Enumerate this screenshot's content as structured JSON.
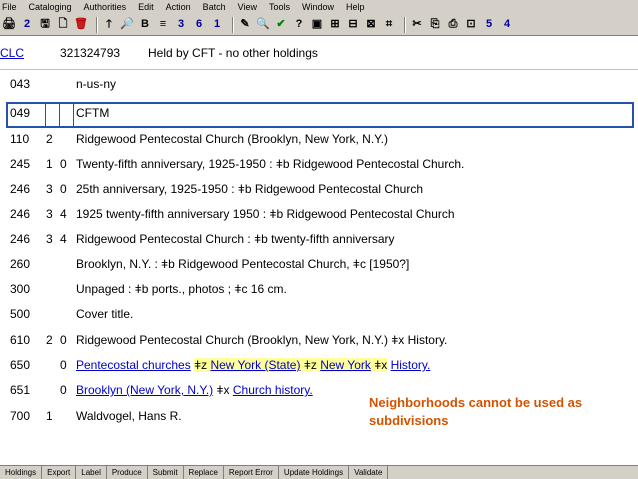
{
  "menu": [
    "File",
    "Cataloging",
    "Authorities",
    "Edit",
    "Action",
    "Batch",
    "View",
    "Tools",
    "Window",
    "Help"
  ],
  "toolbar": [
    "🖨",
    "2",
    "🖫",
    "🗋",
    "🗑",
    "🡑",
    "🔎",
    "B",
    "≡",
    "3",
    "6",
    "1",
    "✎",
    "🔍",
    "✔",
    "?",
    "▣",
    "⊞",
    "⊟",
    "⊠",
    "⌗",
    "✂",
    "⎘",
    "⎙",
    "⊡",
    "5",
    "4"
  ],
  "header": {
    "source": "CLC",
    "ocn": "321324793",
    "holdings": "Held by CFT - no other holdings"
  },
  "records": [
    {
      "tag": "043",
      "ind1": "",
      "ind2": "",
      "content": "n-us-ny"
    },
    {
      "tag": "049",
      "ind1": "",
      "ind2": "",
      "content": "CFTM"
    },
    {
      "tag": "110",
      "ind1": "2",
      "ind2": "",
      "content": "Ridgewood Pentecostal Church (Brooklyn, New York, N.Y.)"
    },
    {
      "tag": "245",
      "ind1": "1",
      "ind2": "0",
      "content": "Twenty-fifth anniversary, 1925-1950 : ǂb Ridgewood Pentecostal Church."
    },
    {
      "tag": "246",
      "ind1": "3",
      "ind2": "0",
      "content": "25th  anniversary, 1925-1950 : ǂb Ridgewood Pentecostal Church"
    },
    {
      "tag": "246",
      "ind1": "3",
      "ind2": "4",
      "content": "1925 twenty-fifth anniversary 1950 : ǂb Ridgewood Pentecostal Church"
    },
    {
      "tag": "246",
      "ind1": "3",
      "ind2": "4",
      "content": "Ridgewood Pentecostal Church : ǂb twenty-fifth anniversary"
    },
    {
      "tag": "260",
      "ind1": "",
      "ind2": "",
      "content": "Brooklyn, N.Y. : ǂb Ridgewood Pentecostal Church, ǂc [1950?]"
    },
    {
      "tag": "300",
      "ind1": "",
      "ind2": "",
      "content": "Unpaged : ǂb ports., photos ; ǂc 16 cm."
    },
    {
      "tag": "500",
      "ind1": "",
      "ind2": "",
      "content": "Cover title."
    },
    {
      "tag": "610",
      "ind1": "2",
      "ind2": "0",
      "content": "Ridgewood Pentecostal Church (Brooklyn, New York, N.Y.) ǂx History."
    }
  ],
  "subject650": {
    "tag": "650",
    "ind2": "0",
    "a": "Pentecostal churches",
    "z1_code": "ǂz",
    "z1": "New York (State)",
    "z2_code": "ǂz",
    "z2": "New York",
    "x_code": "ǂx",
    "x": "History."
  },
  "subject651": {
    "tag": "651",
    "ind2": "0",
    "a": "Brooklyn (New York, N.Y.)",
    "x_code": "ǂx",
    "x": "Church history."
  },
  "record700": {
    "tag": "700",
    "ind1": "1",
    "content": "Waldvogel, Hans R."
  },
  "note": "Neighborhoods cannot be used as subdivisions",
  "bottom_buttons": [
    "Holdings",
    "Export",
    "Label",
    "Produce",
    "Submit",
    "Replace",
    "Report Error",
    "Update Holdings",
    "Validate"
  ],
  "colors": {
    "link": "#0000cc",
    "note": "#d35400",
    "highlight": "#ffff99",
    "edit_border": "#2255aa"
  }
}
